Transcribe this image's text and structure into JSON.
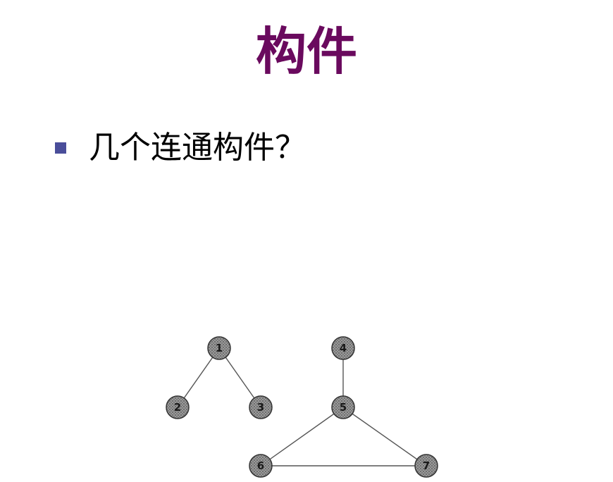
{
  "slide": {
    "title": "构件",
    "bullet_text": "几个连通构件？"
  },
  "graph": {
    "nodes": [
      {
        "id": "1",
        "label": "1"
      },
      {
        "id": "2",
        "label": "2"
      },
      {
        "id": "3",
        "label": "3"
      },
      {
        "id": "4",
        "label": "4"
      },
      {
        "id": "5",
        "label": "5"
      },
      {
        "id": "6",
        "label": "6"
      },
      {
        "id": "7",
        "label": "7"
      }
    ],
    "edges": [
      [
        "1",
        "2"
      ],
      [
        "1",
        "3"
      ],
      [
        "4",
        "5"
      ],
      [
        "5",
        "6"
      ],
      [
        "5",
        "7"
      ],
      [
        "6",
        "7"
      ]
    ]
  },
  "colors": {
    "title": "#6a0a5e",
    "bullet_marker": "#4a4e9a",
    "node_fill": "#8a8a8a",
    "edge": "#555555"
  }
}
